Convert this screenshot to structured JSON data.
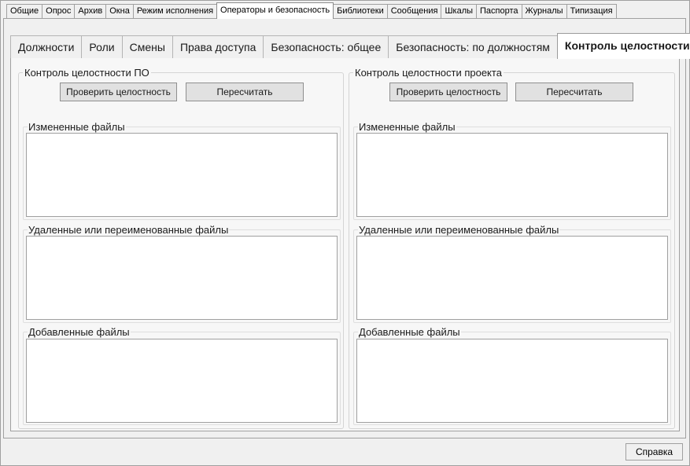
{
  "top_tabs": [
    {
      "label": "Общие"
    },
    {
      "label": "Опрос"
    },
    {
      "label": "Архив"
    },
    {
      "label": "Окна"
    },
    {
      "label": "Режим исполнения"
    },
    {
      "label": "Операторы и безопасность",
      "active": true
    },
    {
      "label": "Библиотеки"
    },
    {
      "label": "Сообщения"
    },
    {
      "label": "Шкалы"
    },
    {
      "label": "Паспорта"
    },
    {
      "label": "Журналы"
    },
    {
      "label": "Типизация"
    }
  ],
  "inner_tabs": [
    {
      "label": "Должности"
    },
    {
      "label": "Роли"
    },
    {
      "label": "Смены"
    },
    {
      "label": "Права доступа"
    },
    {
      "label": "Безопасность: общее"
    },
    {
      "label": "Безопасность: по должностям"
    },
    {
      "label": "Контроль целостности",
      "active": true
    }
  ],
  "left_group": {
    "title": "Контроль целостности ПО",
    "check_button": "Проверить целостность",
    "recalc_button": "Пересчитать",
    "changed_files_label": "Измененные файлы",
    "deleted_files_label": "Удаленные или переименованные файлы",
    "added_files_label": "Добавленные файлы"
  },
  "right_group": {
    "title": "Контроль целостности проекта",
    "check_button": "Проверить целостность",
    "recalc_button": "Пересчитать",
    "changed_files_label": "Измененные файлы",
    "deleted_files_label": "Удаленные или переименованные файлы",
    "added_files_label": "Добавленные файлы"
  },
  "help_button": "Справка"
}
